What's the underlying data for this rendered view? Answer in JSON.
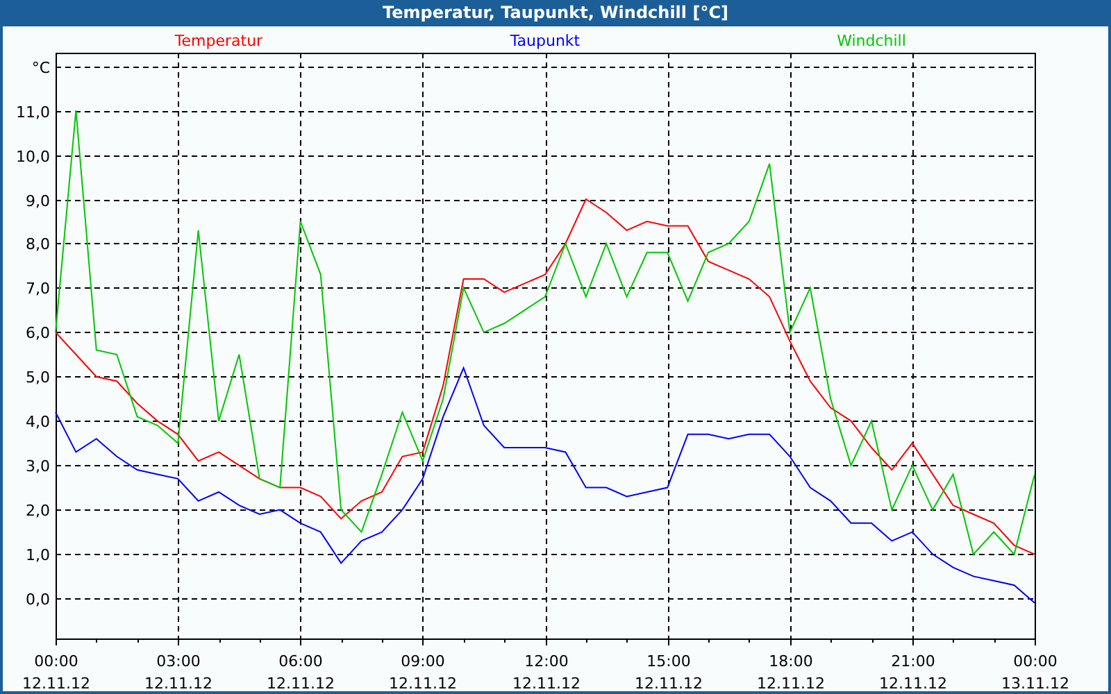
{
  "window": {
    "title": "Temperatur, Taupunkt, Windchill [°C]"
  },
  "chart": {
    "chart_data": {
      "type": "line",
      "categories": [
        "00:00 12.11.12",
        null,
        null,
        null,
        null,
        null,
        "03:00 12.11.12",
        null,
        null,
        null,
        null,
        null,
        "06:00 12.11.12",
        null,
        null,
        null,
        null,
        null,
        "09:00 12.11.12",
        null,
        null,
        null,
        null,
        null,
        "12:00 12.11.12",
        null,
        null,
        null,
        null,
        null,
        "15:00 12.11.12",
        null,
        null,
        null,
        null,
        null,
        "18:00 12.11.12",
        null,
        null,
        null,
        null,
        null,
        "21:00 12.11.12",
        null,
        null,
        null,
        null,
        null,
        "00:00 13.11.12"
      ],
      "series": [
        {
          "name": "Temperatur",
          "color": "#ff0000",
          "values": [
            6.0,
            5.5,
            5.0,
            4.9,
            4.4,
            4.0,
            3.7,
            3.1,
            3.3,
            3.0,
            2.7,
            2.5,
            2.5,
            2.3,
            1.8,
            2.2,
            2.4,
            3.2,
            3.3,
            4.8,
            7.2,
            7.2,
            6.9,
            7.1,
            7.3,
            8.0,
            9.0,
            8.7,
            8.3,
            8.5,
            8.4,
            8.4,
            7.6,
            7.4,
            7.2,
            6.8,
            5.8,
            4.9,
            4.3,
            4.0,
            3.4,
            2.9,
            3.5,
            2.8,
            2.1,
            1.9,
            1.7,
            1.2,
            1.0
          ]
        },
        {
          "name": "Taupunkt",
          "color": "#0000ff",
          "values": [
            4.2,
            3.3,
            3.6,
            3.2,
            2.9,
            2.8,
            2.7,
            2.2,
            2.4,
            2.1,
            1.9,
            2.0,
            1.7,
            1.5,
            0.8,
            1.3,
            1.5,
            2.0,
            2.7,
            4.1,
            5.2,
            3.9,
            3.4,
            3.4,
            3.4,
            3.3,
            2.5,
            2.5,
            2.3,
            2.4,
            2.5,
            3.7,
            3.7,
            3.6,
            3.7,
            3.7,
            3.2,
            2.5,
            2.2,
            1.7,
            1.7,
            1.3,
            1.5,
            1.0,
            0.7,
            0.5,
            0.4,
            0.3,
            -0.1
          ]
        },
        {
          "name": "Windchill",
          "color": "#00c800",
          "values": [
            6.0,
            11.0,
            5.6,
            5.5,
            4.1,
            3.9,
            3.5,
            8.3,
            4.0,
            5.5,
            2.7,
            2.5,
            8.5,
            7.3,
            2.0,
            1.5,
            2.8,
            4.2,
            3.1,
            4.5,
            7.0,
            6.0,
            6.2,
            6.5,
            6.8,
            8.0,
            6.8,
            8.0,
            6.8,
            7.8,
            7.8,
            6.7,
            7.8,
            8.0,
            8.5,
            9.8,
            6.0,
            7.0,
            4.5,
            3.0,
            4.0,
            2.0,
            3.0,
            2.0,
            2.8,
            1.0,
            1.5,
            1.0,
            2.8
          ]
        }
      ],
      "ylim": [
        -0.9,
        12.3
      ],
      "grid": true,
      "yticks": [
        {
          "value": 0,
          "label": "0,0"
        },
        {
          "value": 1,
          "label": "1,0"
        },
        {
          "value": 2,
          "label": "2,0"
        },
        {
          "value": 3,
          "label": "3,0"
        },
        {
          "value": 4,
          "label": "4,0"
        },
        {
          "value": 5,
          "label": "5,0"
        },
        {
          "value": 6,
          "label": "6,0"
        },
        {
          "value": 7,
          "label": "7,0"
        },
        {
          "value": 8,
          "label": "8,0"
        },
        {
          "value": 9,
          "label": "9,0"
        },
        {
          "value": 10,
          "label": "10,0"
        },
        {
          "value": 11,
          "label": "11,0"
        },
        {
          "value": 12,
          "label": "°C"
        }
      ]
    }
  }
}
